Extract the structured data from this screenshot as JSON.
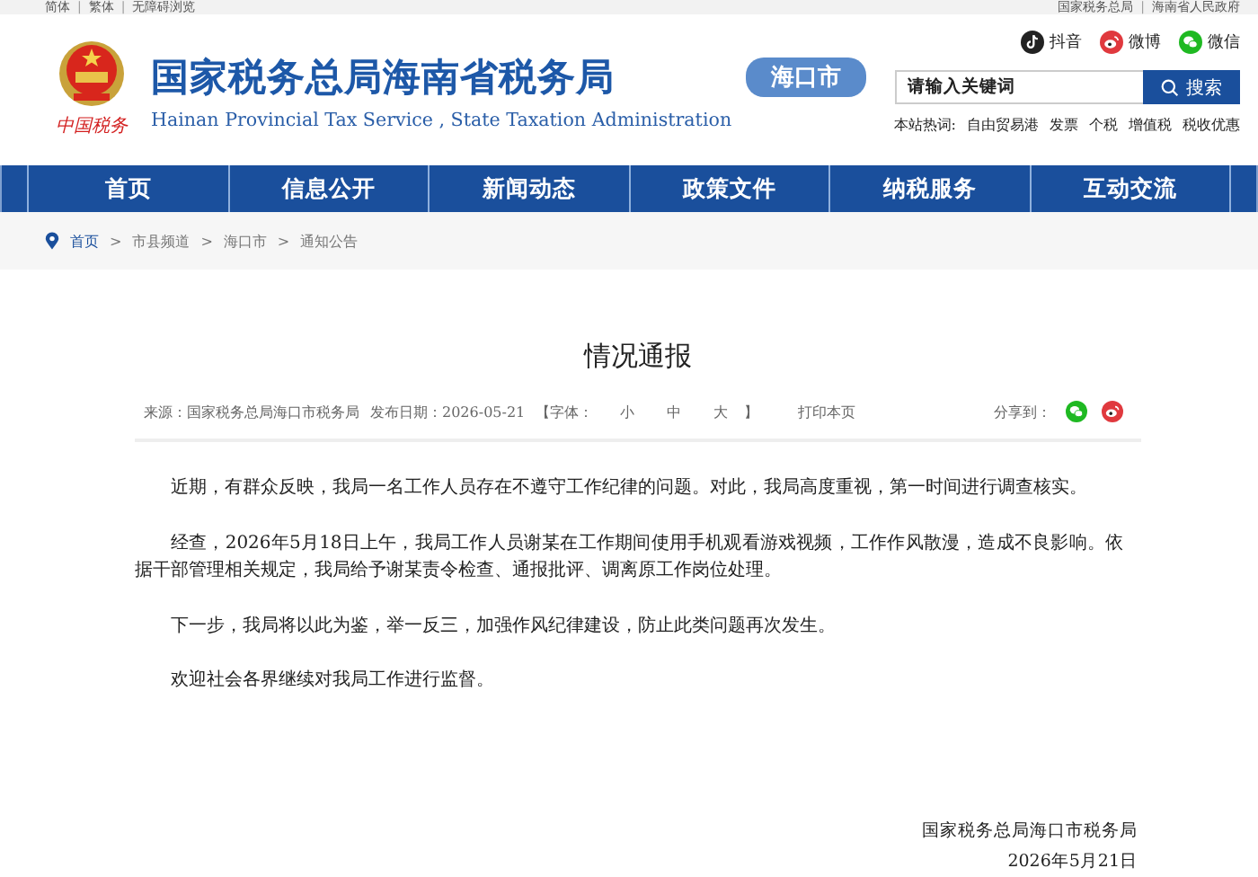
{
  "top_bar": {
    "separator": "|",
    "left": [
      "简体",
      "繁体",
      "无障碍浏览"
    ],
    "right": [
      "国家税务总局",
      "海南省人民政府"
    ]
  },
  "header": {
    "logo_text": "中国税务",
    "title": "国家税务总局海南省税务局",
    "subtitle": "Hainan Provincial Tax Service , State Taxation Administration",
    "city_badge": "海口市",
    "social": [
      {
        "kind": "douyin",
        "label": "抖音"
      },
      {
        "kind": "weibo",
        "label": "微博"
      },
      {
        "kind": "wechat",
        "label": "微信"
      }
    ],
    "search": {
      "placeholder": "请输入关键词",
      "button": "搜索"
    },
    "hot_words": {
      "label": "本站热词:",
      "items": [
        "自由贸易港",
        "发票",
        "个税",
        "增值税",
        "税收优惠"
      ]
    }
  },
  "nav": [
    {
      "label": "首页",
      "selected": false
    },
    {
      "label": "信息公开",
      "selected": false
    },
    {
      "label": "新闻动态",
      "selected": false
    },
    {
      "label": "政策文件",
      "selected": false
    },
    {
      "label": "纳税服务",
      "selected": false
    },
    {
      "label": "互动交流",
      "selected": false
    }
  ],
  "breadcrumb": {
    "separator": ">",
    "items": [
      "首页",
      "市县频道",
      "海口市",
      "通知公告"
    ]
  },
  "article": {
    "title": "情况通报",
    "meta": {
      "source": "来源：国家税务总局海口市税务局",
      "date": "发布日期：2026-05-21",
      "font_open": "【字体：",
      "font_sizes": [
        "小",
        "中",
        "大"
      ],
      "font_close": "】",
      "print": "打印本页",
      "share_label": "分享到：",
      "share": [
        {
          "kind": "wechat"
        },
        {
          "kind": "weibo"
        }
      ]
    },
    "paragraphs": [
      "近期，有群众反映，我局一名工作人员存在不遵守工作纪律的问题。对此，我局高度重视，第一时间进行调查核实。",
      "经查，2026年5月18日上午，我局工作人员谢某在工作期间使用手机观看游戏视频，工作作风散漫，造成不良影响。依据干部管理相关规定，我局给予谢某责令检查、通报批评、调离原工作岗位处理。",
      "下一步，我局将以此为鉴，举一反三，加强作风纪律建设，防止此类问题再次发生。",
      "欢迎社会各界继续对我局工作进行监督。"
    ],
    "signature": [
      "国家税务总局海口市税务局",
      "2026年5月21日"
    ]
  }
}
